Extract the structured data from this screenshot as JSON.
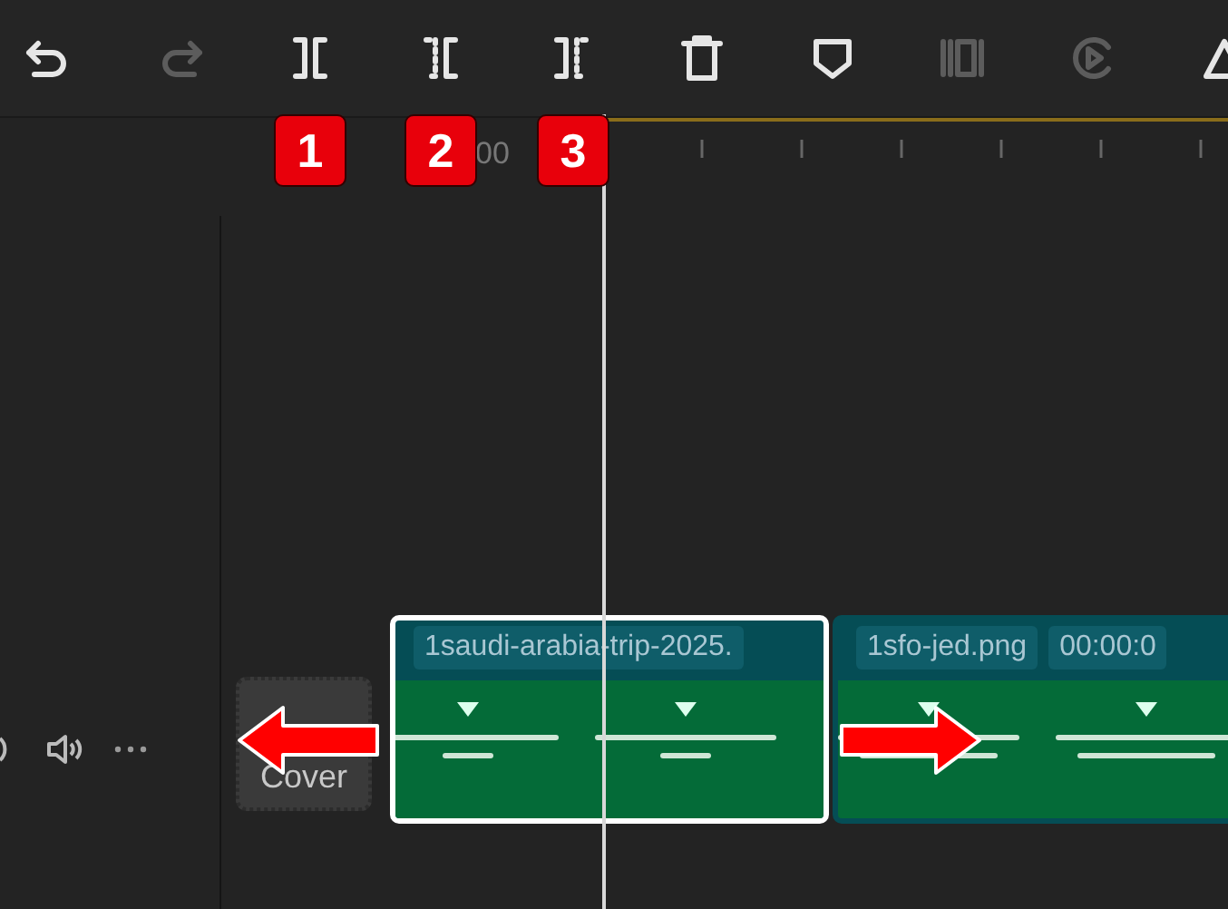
{
  "toolbar": {
    "buttons": [
      {
        "kind": "undo",
        "disabled": false
      },
      {
        "kind": "redo",
        "disabled": true
      },
      {
        "kind": "split",
        "disabled": false
      },
      {
        "kind": "trim-start",
        "disabled": false
      },
      {
        "kind": "trim-end",
        "disabled": false
      },
      {
        "kind": "delete",
        "disabled": false
      },
      {
        "kind": "marker",
        "disabled": false
      },
      {
        "kind": "freeze",
        "disabled": true
      },
      {
        "kind": "speed",
        "disabled": true
      },
      {
        "kind": "triangle",
        "disabled": false
      }
    ]
  },
  "ruler": {
    "label": "00"
  },
  "cover": {
    "label": "Cover"
  },
  "clips": [
    {
      "name": "1saudi-arabia-trip-2025.",
      "selected": true
    },
    {
      "name": "1sfo-jed.png",
      "duration": "00:00:0",
      "selected": false
    }
  ],
  "annotations": {
    "badges": [
      "1",
      "2",
      "3"
    ],
    "arrows": [
      {
        "kind": "left"
      },
      {
        "kind": "right"
      }
    ]
  }
}
